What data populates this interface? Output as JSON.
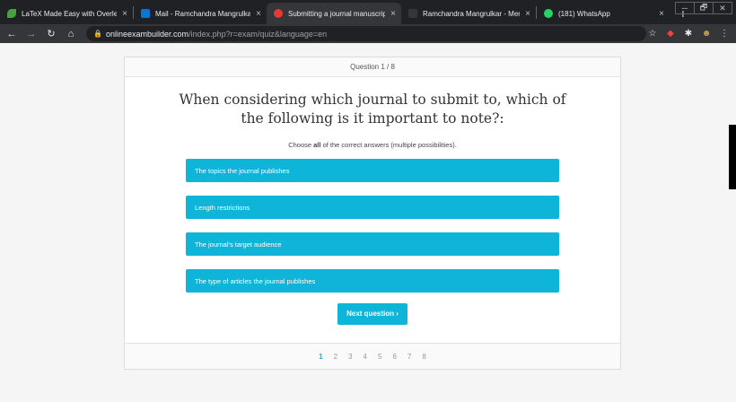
{
  "browser": {
    "tabs": [
      {
        "label": "LaTeX Made Easy with Overleaf (p",
        "icon": "overleaf-leaf-icon",
        "color": "#47a141",
        "active": false
      },
      {
        "label": "Mail - Ramchandra Mangrulkar - O",
        "icon": "outlook-mail-icon",
        "color": "#0078d4",
        "active": false
      },
      {
        "label": "Submitting a journal manuscript ar",
        "icon": "exam-icon",
        "color": "#e53935",
        "active": true
      },
      {
        "label": "Ramchandra Mangrulkar - Mendel",
        "icon": "mendeley-icon",
        "color": "#9c2a2a",
        "active": false
      },
      {
        "label": "(181) WhatsApp",
        "icon": "whatsapp-icon",
        "color": "#25d366",
        "active": false
      }
    ],
    "tab_close": "×",
    "new_tab": "+",
    "window_controls": [
      "─",
      "🗗",
      "✕"
    ],
    "url_host": "onlineexambuilder.com",
    "url_path": "/index.php?r=exam/quiz&language=en"
  },
  "quiz": {
    "header": "Question 1 / 8",
    "question": "When considering which journal to submit to, which of the following is it important to note?:",
    "instruction_prefix": "Choose ",
    "instruction_bold": "all",
    "instruction_suffix": " of the correct answers (multiple possibilities).",
    "answers": [
      "The topics the journal publishes",
      "Length restrictions",
      "The journal's target audience",
      "The type of articles the journal publishes"
    ],
    "next_label": "Next question ›",
    "pages": [
      "1",
      "2",
      "3",
      "4",
      "5",
      "6",
      "7",
      "8"
    ],
    "current_page": "1",
    "accent_color": "#0fb5d8"
  }
}
